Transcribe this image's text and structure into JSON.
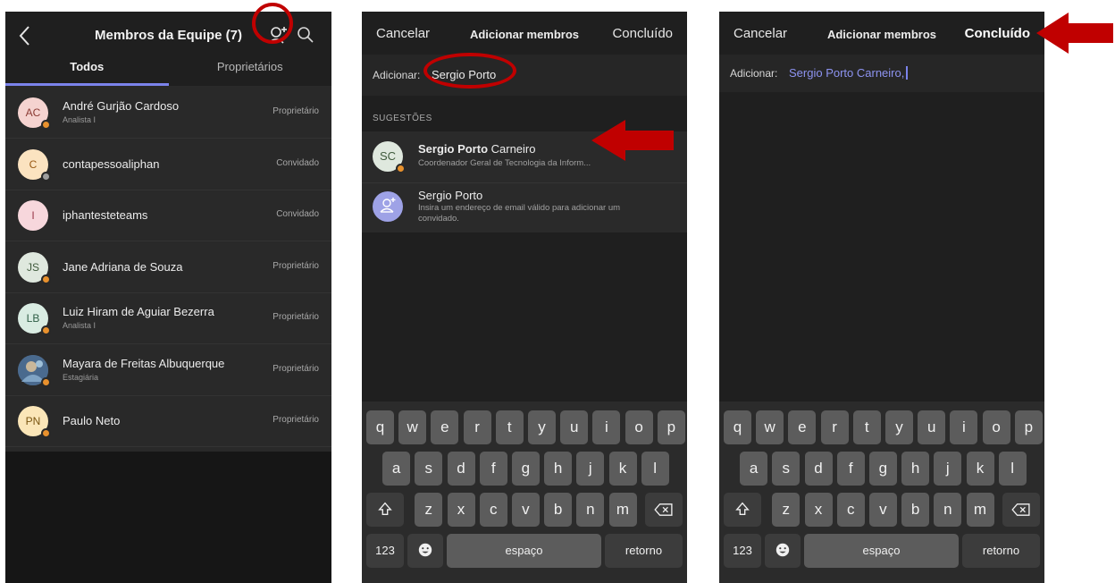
{
  "screen1": {
    "title": "Membros da Equipe (7)",
    "tabs": [
      {
        "label": "Todos"
      },
      {
        "label": "Proprietários"
      }
    ],
    "members": [
      {
        "initials": "AC",
        "name": "André Gurjão Cardoso",
        "subtitle": "Analista I",
        "role": "Proprietário",
        "avatar_bg": "#f5d3d0",
        "avatar_fg": "#8a3a33",
        "presence": "#e8912d"
      },
      {
        "initials": "C",
        "name": "contapessoaliphan",
        "subtitle": "",
        "role": "Convidado",
        "avatar_bg": "#fbe3c0",
        "avatar_fg": "#9a5a14",
        "presence": "#9e9e9e"
      },
      {
        "initials": "I",
        "name": "iphantesteteams",
        "subtitle": "",
        "role": "Convidado",
        "avatar_bg": "#f7d7dc",
        "avatar_fg": "#9a3648",
        "presence": ""
      },
      {
        "initials": "JS",
        "name": "Jane Adriana de Souza",
        "subtitle": "",
        "role": "Proprietário",
        "avatar_bg": "#dfe8de",
        "avatar_fg": "#3f5a3c",
        "presence": "#e8912d"
      },
      {
        "initials": "LB",
        "name": "Luiz Hiram de Aguiar Bezerra",
        "subtitle": "Analista I",
        "role": "Proprietário",
        "avatar_bg": "#d9ece2",
        "avatar_fg": "#2f5e46",
        "presence": "#e8912d"
      },
      {
        "initials": "",
        "name": "Mayara de Freitas Albuquerque",
        "subtitle": "Estagiária",
        "role": "Proprietário",
        "avatar_bg": "#5a7391",
        "avatar_fg": "#ffffff",
        "presence": "#e8912d"
      },
      {
        "initials": "PN",
        "name": "Paulo Neto",
        "subtitle": "",
        "role": "Proprietário",
        "avatar_bg": "#fbe6b8",
        "avatar_fg": "#7a5512",
        "presence": "#e8912d"
      }
    ]
  },
  "screen2": {
    "cancel_label": "Cancelar",
    "title": "Adicionar membros",
    "done_label": "Concluído",
    "add_label": "Adicionar:",
    "add_value": "Sergio Porto",
    "suggestions_label": "SUGESTÕES",
    "suggestions": [
      {
        "initials": "SC",
        "name_bold": "Sergio Porto",
        "name_rest": " Carneiro",
        "subtitle": "Coordenador Geral de Tecnologia da Inform..."
      },
      {
        "initials": "",
        "name_bold": "",
        "name_rest": "Sergio Porto",
        "subtitle": "Insira um endereço de email válido para adicionar um convidado."
      }
    ]
  },
  "screen3": {
    "cancel_label": "Cancelar",
    "title": "Adicionar membros",
    "done_label": "Concluído",
    "add_label": "Adicionar:",
    "add_value": "Sergio Porto Carneiro,"
  },
  "keyboard": {
    "row1": [
      "q",
      "w",
      "e",
      "r",
      "t",
      "y",
      "u",
      "i",
      "o",
      "p"
    ],
    "row2": [
      "a",
      "s",
      "d",
      "f",
      "g",
      "h",
      "j",
      "k",
      "l"
    ],
    "row3": [
      "z",
      "x",
      "c",
      "v",
      "b",
      "n",
      "m"
    ],
    "numbers_label": "123",
    "space_label": "espaço",
    "return_label": "retorno"
  },
  "colors": {
    "accent": "#7b83eb",
    "annotation_red": "#c00000"
  }
}
